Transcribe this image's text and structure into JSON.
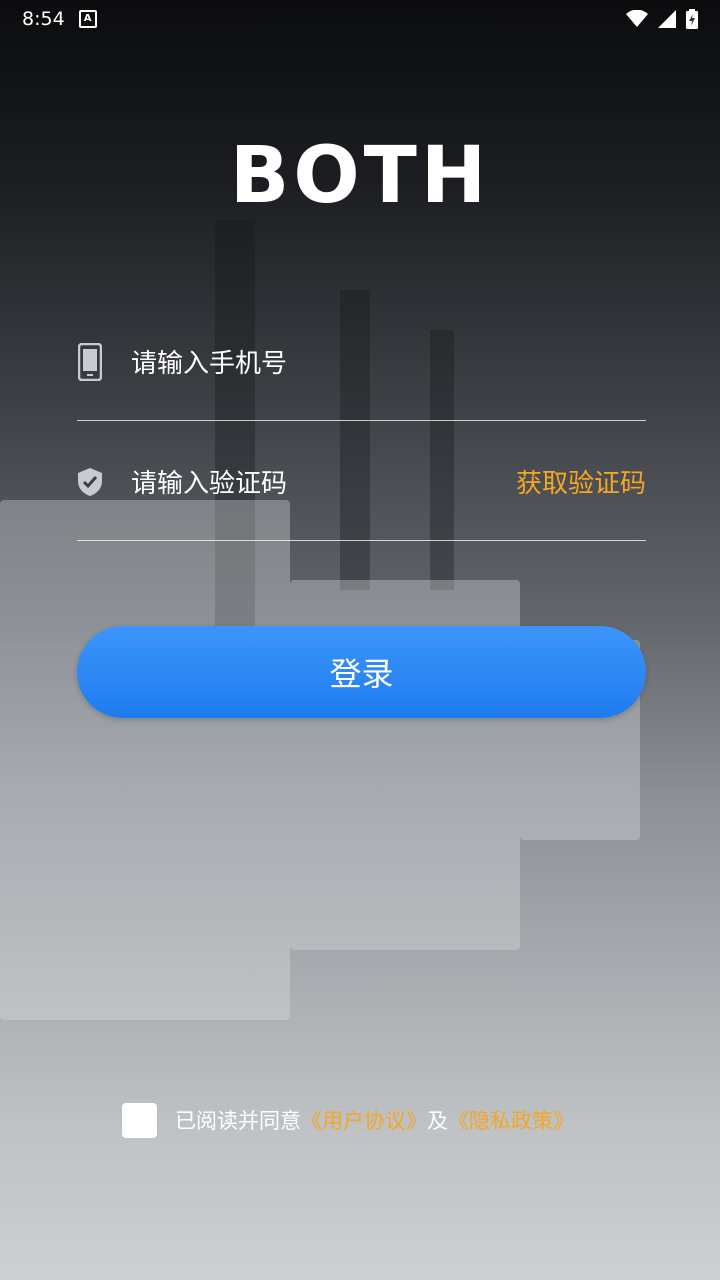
{
  "status_bar": {
    "time": "8:54",
    "notification_icon": "A"
  },
  "logo": "BOTH",
  "phone_field": {
    "icon": "phone-icon",
    "placeholder": "请输入手机号"
  },
  "code_field": {
    "icon": "shield-check-icon",
    "placeholder": "请输入验证码",
    "get_code_label": "获取验证码"
  },
  "login_button": "登录",
  "agreement": {
    "prefix": "已阅读并同意",
    "user_agreement": "《用户协议》",
    "conjunction": "及",
    "privacy_policy": "《隐私政策》"
  },
  "colors": {
    "accent": "#f5a623",
    "button": "#2b88f5"
  }
}
